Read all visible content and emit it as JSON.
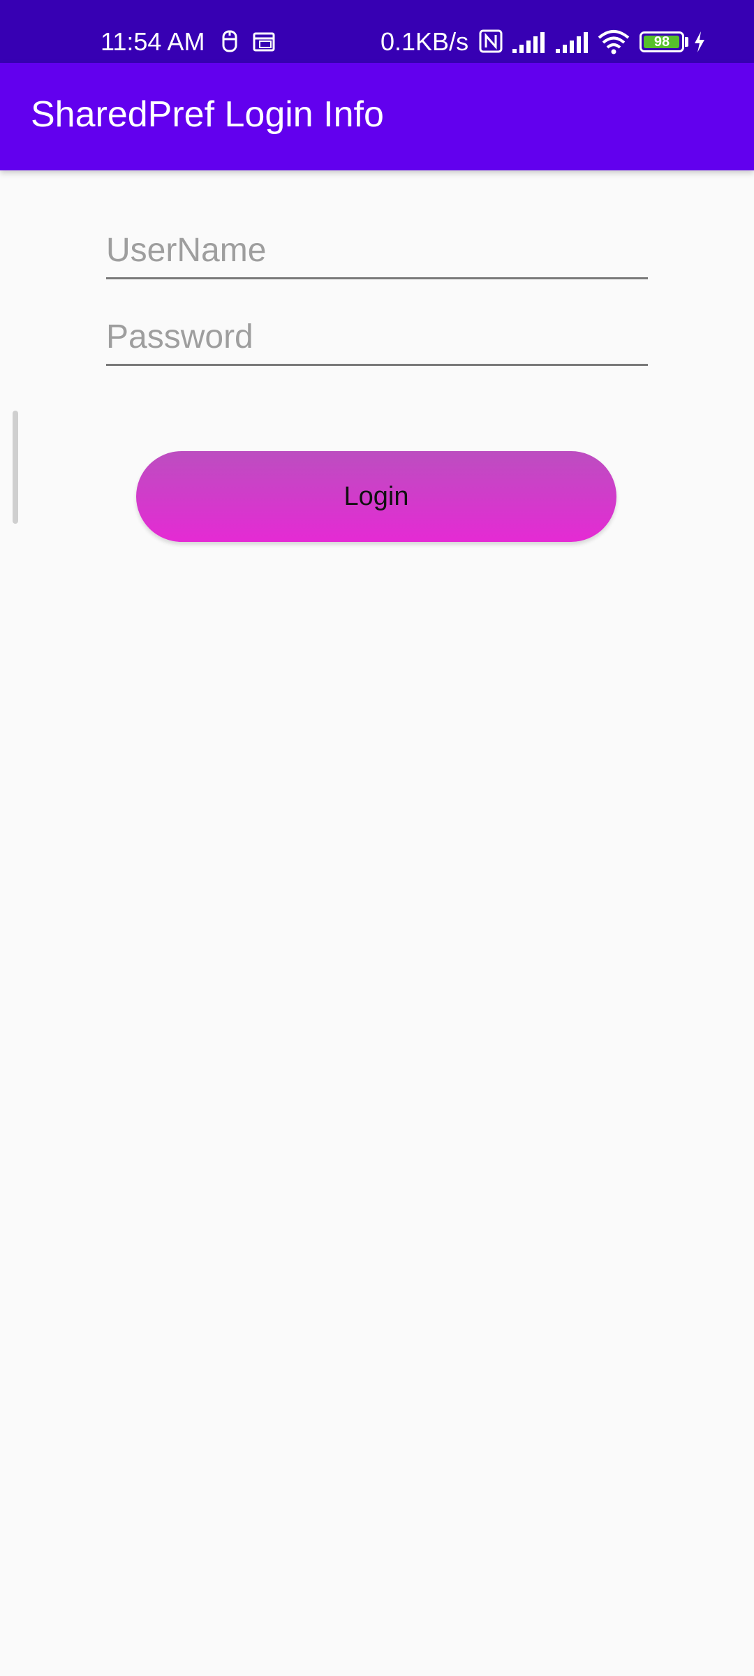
{
  "status_bar": {
    "time": "11:54 AM",
    "speed": "0.1KB/s",
    "battery_level": "98",
    "battery_fraction": 0.98,
    "icons": [
      "notification-icon",
      "calendar-icon",
      "nfc-icon",
      "signal-icon",
      "signal-icon",
      "wifi-icon",
      "battery-icon",
      "charging-icon"
    ],
    "background_color": "#3700b3"
  },
  "app_bar": {
    "title": "SharedPref Login Info",
    "background_color": "#6200ee"
  },
  "form": {
    "username_placeholder": "UserName",
    "username_value": "",
    "password_placeholder": "Password",
    "password_value": "",
    "login_label": "Login"
  },
  "colors": {
    "page_background": "#fafafa",
    "button_gradient_top": "#bc4ec0",
    "button_gradient_bottom": "#e52ad4"
  }
}
